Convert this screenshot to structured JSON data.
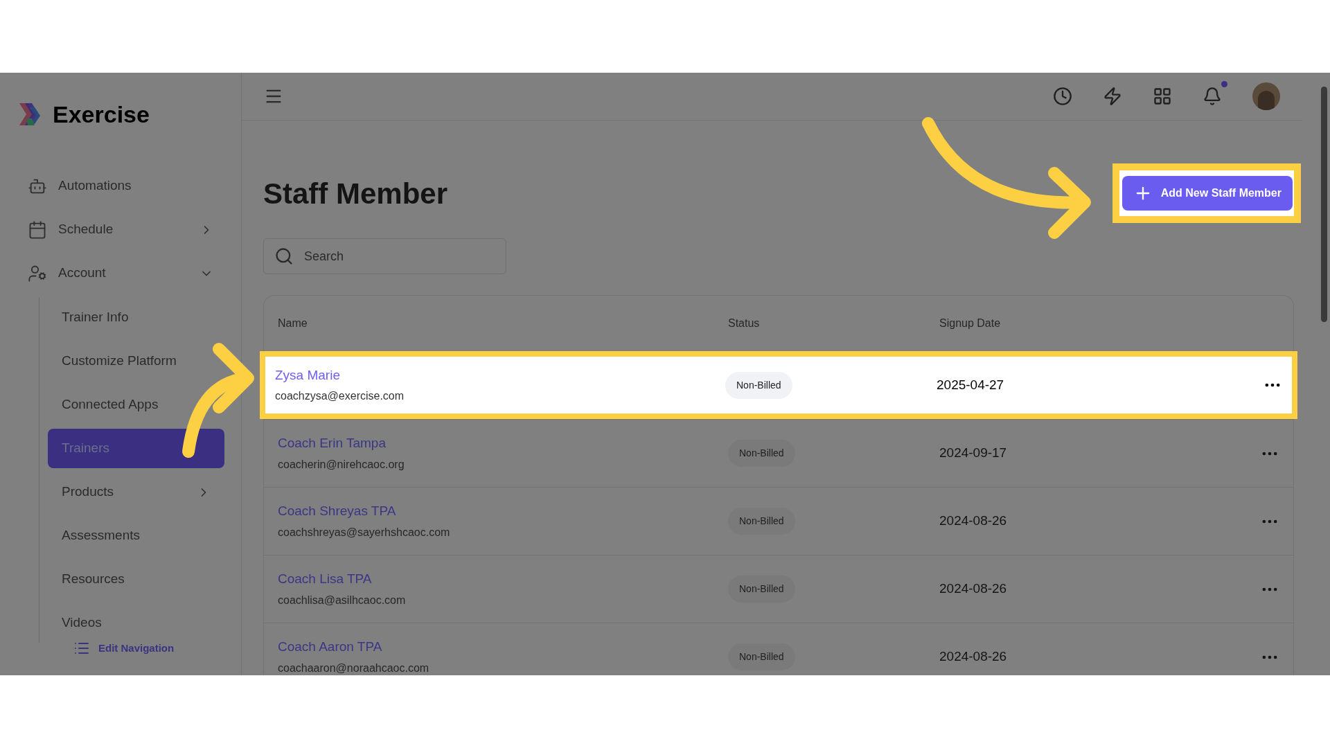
{
  "sidebar": {
    "logo": "Exercise",
    "items": [
      {
        "label": "Automations",
        "selected": false
      },
      {
        "label": "Schedule",
        "selected": false,
        "expanded": false
      },
      {
        "label": "Account",
        "selected": false,
        "expanded": true,
        "children": [
          {
            "label": "Trainer Info",
            "selected": false
          },
          {
            "label": "Customize Platform",
            "selected": false
          },
          {
            "label": "Connected Apps",
            "selected": false
          },
          {
            "label": "Trainers",
            "selected": true
          },
          {
            "label": "Products",
            "selected": false,
            "expanded": false
          },
          {
            "label": "Assessments",
            "selected": false
          },
          {
            "label": "Resources",
            "selected": false
          },
          {
            "label": "Videos",
            "selected": false
          }
        ]
      }
    ],
    "edit_link": "Edit Navigation"
  },
  "header": {
    "notification_dot": true
  },
  "page": {
    "title": "Staff Member",
    "add_button": {
      "label": "Add New Staff Member",
      "highlighted": true
    },
    "search": {
      "placeholder": "Search"
    }
  },
  "table": {
    "columns": [
      "Name",
      "Status",
      "Signup Date"
    ],
    "rows": [
      {
        "name": "Zysa Marie",
        "email": "coachzysa@exercise.com",
        "status": "Non-Billed",
        "date": "2025-04-27",
        "selected": true
      },
      {
        "name": "Coach Erin Tampa",
        "email": "coacherin@nirehcaoc.org",
        "status": "Non-Billed",
        "date": "2024-09-17",
        "selected": false
      },
      {
        "name": "Coach Shreyas TPA",
        "email": "coachshreyas@sayerhshcaoc.com",
        "status": "Non-Billed",
        "date": "2024-08-26",
        "selected": false
      },
      {
        "name": "Coach Lisa TPA",
        "email": "coachlisa@asilhcaoc.com",
        "status": "Non-Billed",
        "date": "2024-08-26",
        "selected": false
      },
      {
        "name": "Coach Aaron TPA",
        "email": "coachaaron@noraahcaoc.com",
        "status": "Non-Billed",
        "date": "2024-08-26",
        "selected": false
      }
    ]
  }
}
